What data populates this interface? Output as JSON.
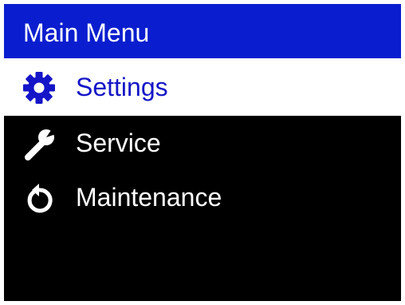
{
  "header": {
    "title": "Main Menu"
  },
  "menu": {
    "items": [
      {
        "label": "Settings",
        "icon": "gear-icon",
        "selected": true
      },
      {
        "label": "Service",
        "icon": "wrench-icon",
        "selected": false
      },
      {
        "label": "Maintenance",
        "icon": "reset-arrow-icon",
        "selected": false
      }
    ]
  },
  "colors": {
    "header_background": "#0a1ecf",
    "screen_background": "#000000",
    "selected_background": "#ffffff",
    "selected_text": "#1515c8",
    "text": "#ffffff"
  }
}
